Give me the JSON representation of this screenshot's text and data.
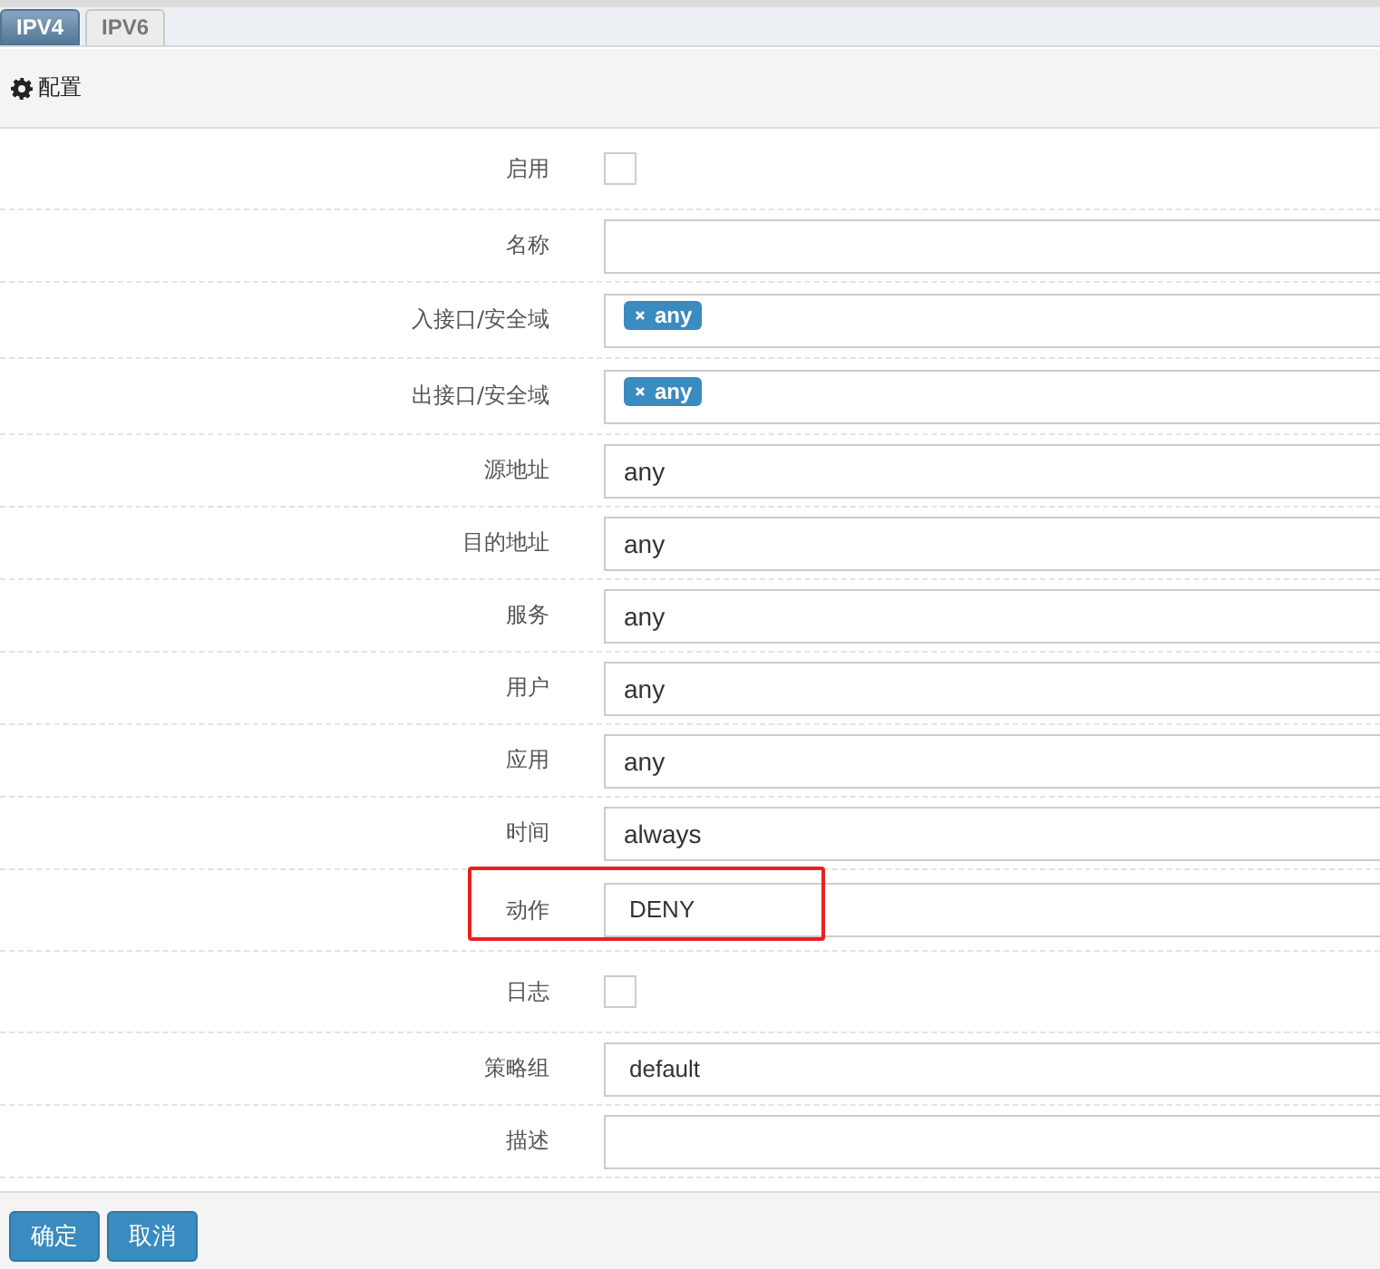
{
  "tabs": [
    {
      "label": "IPV4",
      "selected": true
    },
    {
      "label": "IPV6",
      "selected": false
    }
  ],
  "panel": {
    "title": "配置"
  },
  "fields": [
    {
      "label": "启用",
      "kind": "checkbox",
      "checked": false,
      "highlighted": false
    },
    {
      "label": "名称",
      "kind": "input",
      "highlighted": false
    },
    {
      "label": "入接口/安全域",
      "kind": "tags",
      "tags": [
        "any"
      ],
      "highlighted": false
    },
    {
      "label": "出接口/安全域",
      "kind": "tags",
      "tags": [
        "any"
      ],
      "highlighted": false
    },
    {
      "label": "源地址",
      "kind": "input",
      "value": "any",
      "highlighted": false
    },
    {
      "label": "目的地址",
      "kind": "input",
      "value": "any",
      "highlighted": false
    },
    {
      "label": "服务",
      "kind": "input",
      "value": "any",
      "highlighted": false
    },
    {
      "label": "用户",
      "kind": "input",
      "value": "any",
      "highlighted": false
    },
    {
      "label": "应用",
      "kind": "input",
      "value": "any",
      "highlighted": false
    },
    {
      "label": "时间",
      "kind": "input",
      "value": "always",
      "highlighted": false
    },
    {
      "label": "动作",
      "kind": "select",
      "value": "DENY",
      "highlighted": true
    },
    {
      "label": "日志",
      "kind": "checkbox",
      "checked": false,
      "highlighted": false
    },
    {
      "label": "策略组",
      "kind": "select",
      "value": "default",
      "highlighted": false
    },
    {
      "label": "描述",
      "kind": "input",
      "highlighted": false
    }
  ],
  "buttons": [
    "确定",
    "取消"
  ]
}
